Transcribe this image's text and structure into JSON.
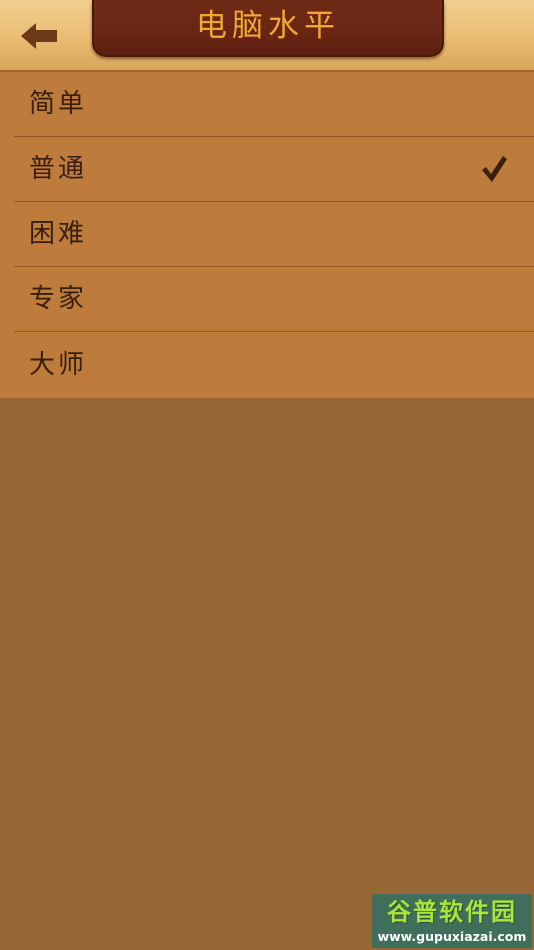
{
  "header": {
    "title": "电脑水平",
    "back_icon": "arrow-left-icon"
  },
  "options": [
    {
      "label": "简单",
      "selected": false
    },
    {
      "label": "普通",
      "selected": true
    },
    {
      "label": "困难",
      "selected": false
    },
    {
      "label": "专家",
      "selected": false
    },
    {
      "label": "大师",
      "selected": false
    }
  ],
  "selection_icon": "checkmark-icon",
  "watermark": {
    "main": "谷普软件园",
    "url": "www.gupuxiazai.com"
  },
  "colors": {
    "header_wood": "#e9bd73",
    "title_plaque": "#6a2514",
    "title_text": "#f0a735",
    "list_background": "#bd7c3c",
    "page_background": "#976835",
    "text": "#3a1e0c",
    "check": "#3b1e0c"
  }
}
